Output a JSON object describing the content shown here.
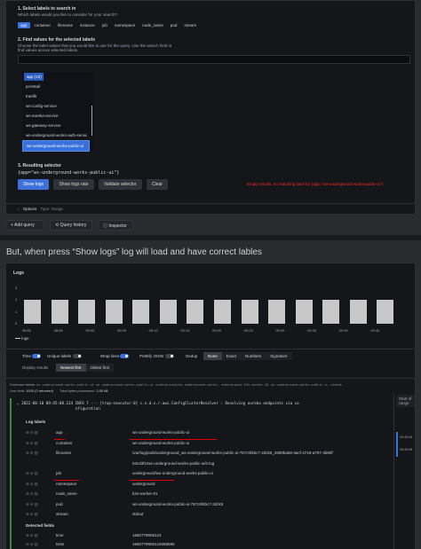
{
  "query": {
    "step1": {
      "title": "1. Select labels to search in",
      "subtitle": "Which labels would you like to consider for your search?",
      "labels": [
        "app",
        "container",
        "filename",
        "instance",
        "job",
        "namespace",
        "node_name",
        "pod",
        "stream"
      ]
    },
    "step2": {
      "title": "2. Find values for the selected labels",
      "subtitle1": "Choose the label values that you would like to use for the query. Use the search field to",
      "subtitle2": "find values across selected labels.",
      "list_header": "app (10)",
      "values": [
        "promtail",
        "traefik",
        "ws-config-service",
        "ws-eureka-service",
        "ws-gateway-service",
        "ws-underground-works-auth-servic",
        "ws-underground-works-public-ui"
      ]
    },
    "step3": {
      "title": "3. Resulting selector",
      "selector": "{app=\"ws-underground-works-public-ui\"}"
    },
    "buttons": {
      "show_logs": "Show logs",
      "show_logs_rate": "Show logs rate",
      "validate": "Validate selector",
      "clear": "Clear"
    },
    "error": "Empty results, no matching label for {app=\"ws-underground-works-public-ui\"}",
    "options_label": "Options",
    "options_value": "Type: Range"
  },
  "toolbar": {
    "add_query": "Add query",
    "query_history": "Query history",
    "inspector": "Inspector"
  },
  "caption": "But, when press “Show logs” log will load and have correct lables",
  "logs": {
    "title": "Logs",
    "chart_data": {
      "type": "bar",
      "categories": [
        "08:50",
        "08:55",
        "09:00",
        "09:05",
        "09:10",
        "09:15",
        "09:20",
        "09:25",
        "09:30",
        "09:35",
        "09:40",
        "09:45"
      ],
      "values": [
        2,
        2,
        2,
        2,
        2,
        2,
        2,
        2,
        2,
        2,
        2,
        2,
        2,
        2
      ],
      "ylim": [
        0,
        3
      ],
      "yticks": [
        "3",
        "2",
        "1",
        "0"
      ],
      "legend": "logs"
    },
    "options": {
      "time": "Time",
      "unique": "Unique labels",
      "wrap": "Wrap lines",
      "prettify": "Prettify JSON",
      "dedup": "Dedup",
      "dedup_modes": [
        "None",
        "Exact",
        "Numbers",
        "Signature"
      ]
    },
    "display": {
      "label": "Display results",
      "newest": "Newest first",
      "oldest": "Oldest first"
    },
    "common_labels": "Common labels:",
    "common_values": "ws-underground-works-public-ui  ws-underground-works-public-ui  underground/ws-underground-works…  underground  k3s-worker-01  ws-underground-works-public-u…  stdout",
    "line_limit": "Line limit:",
    "line_limit_value": "1000 (3 returned)",
    "bytes": "Total bytes processed:",
    "bytes_value": "1.88 kB",
    "entry": {
      "timestamp": "2022-08-18 09:45:08",
      "line1": "2022-08-18 09:45:08.124  INFO 7 --- [trap-executor-0] c.n.d.s.r.aws.ConfigClusterResolver       : Resolving eureka endpoints via co",
      "line2": "nfiguration"
    },
    "log_labels_title": "Log labels",
    "labels": [
      {
        "key": "app",
        "value": "ws-underground-works-public-ui"
      },
      {
        "key": "container",
        "value": "ws-underground-works-public-ui"
      },
      {
        "key": "filename",
        "value": "/var/log/pods/underground_ws-underground-works-public-ui-767c9f4bc7-2dzk5_2680ba59-3acf-4718-a797-4b80f"
      },
      {
        "key": "",
        "value": "04cd3f1/ws-underground-works-public-ui/0.log"
      },
      {
        "key": "job",
        "value": "underground/ws-underground-works-public-ui"
      },
      {
        "key": "namespace",
        "value": "underground"
      },
      {
        "key": "node_name",
        "value": "k3s-worker-01"
      },
      {
        "key": "pod",
        "value": "ws-underground-works-public-ui-767c9f4bc7-2dzk5"
      },
      {
        "key": "stream",
        "value": "stdout"
      }
    ],
    "detected_title": "Detected fields",
    "detected": [
      {
        "key": "time",
        "value": "1660779908124"
      },
      {
        "key": "tsNs",
        "value": "1660779908124658590"
      }
    ],
    "side": {
      "start": "Start of range",
      "t1": "09:45:06",
      "t2": "09:45:08"
    }
  }
}
